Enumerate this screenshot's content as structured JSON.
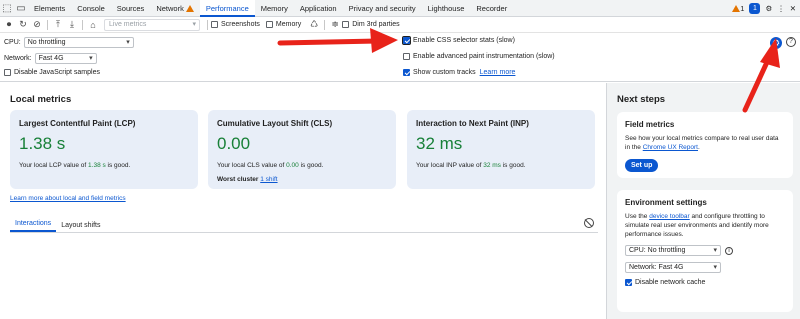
{
  "tabs": {
    "items": [
      {
        "label": "Elements"
      },
      {
        "label": "Console"
      },
      {
        "label": "Sources"
      },
      {
        "label": "Network"
      },
      {
        "label": "Performance"
      },
      {
        "label": "Memory"
      },
      {
        "label": "Application"
      },
      {
        "label": "Privacy and security"
      },
      {
        "label": "Lighthouse"
      },
      {
        "label": "Recorder"
      }
    ],
    "active": "Performance",
    "warning_count": "1",
    "blue_badge": "1"
  },
  "toolbar": {
    "live_select_value": "Live metrics",
    "screenshots_label": "Screenshots",
    "memory_label": "Memory",
    "dim_label": "Dim 3rd parties"
  },
  "settings": {
    "cpu_label": "CPU:",
    "cpu_value": "No throttling",
    "network_label": "Network:",
    "network_value": "Fast 4G",
    "disable_js_label": "Disable JavaScript samples",
    "css_stats_label": "Enable CSS selector stats (slow)",
    "paint_label": "Enable advanced paint instrumentation (slow)",
    "custom_tracks_label": "Show custom tracks",
    "learn_more_label": "Learn more"
  },
  "local_metrics": {
    "heading": "Local metrics",
    "cards": [
      {
        "title": "Largest Contentful Paint (LCP)",
        "value": "1.38 s",
        "desc_pre": "Your local LCP value of ",
        "desc_val": "1.38 s",
        "desc_post": " is good."
      },
      {
        "title": "Cumulative Layout Shift (CLS)",
        "value": "0.00",
        "desc_pre": "Your local CLS value of ",
        "desc_val": "0.00",
        "desc_post": " is good.",
        "extra_label": "Worst cluster",
        "extra_link": "1 shift"
      },
      {
        "title": "Interaction to Next Paint (INP)",
        "value": "32 ms",
        "desc_pre": "Your local INP value of ",
        "desc_val": "32 ms",
        "desc_post": " is good."
      }
    ],
    "learn_link": "Learn more about local and field metrics",
    "subtabs": [
      {
        "label": "Interactions"
      },
      {
        "label": "Layout shifts"
      }
    ]
  },
  "next_steps": {
    "heading": "Next steps",
    "field": {
      "title": "Field metrics",
      "desc_pre": "See how your local metrics compare to real user data in the ",
      "desc_link": "Chrome UX Report",
      "desc_post": ".",
      "button": "Set up"
    },
    "env": {
      "title": "Environment settings",
      "desc_pre": "Use the ",
      "desc_link": "device toolbar",
      "desc_post": " and configure throttling to simulate real user environments and identify more performance issues.",
      "cpu_value": "CPU: No throttling",
      "network_value": "Network: Fast 4G",
      "disable_cache_label": "Disable network cache"
    }
  },
  "colors": {
    "accent": "#0b57d0",
    "good": "#188038",
    "card_bg": "#e8eef8",
    "arrow": "#e8231a"
  }
}
